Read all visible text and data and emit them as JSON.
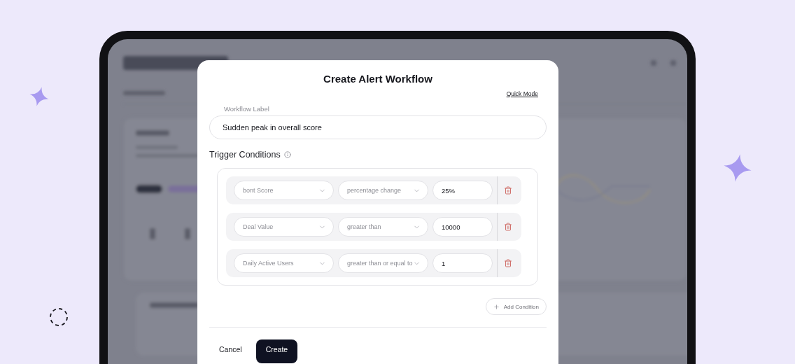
{
  "modal": {
    "title": "Create Alert Workflow",
    "quick_mode_link": "Quick Mode",
    "workflow_label": {
      "label": "Workflow Label",
      "value": "Sudden peak in overall score"
    },
    "trigger_conditions": {
      "title": "Trigger Conditions",
      "conditions": [
        {
          "metric": "bont Score",
          "operator": "percentage change",
          "value": "25%"
        },
        {
          "metric": "Deal Value",
          "operator": "greater than",
          "value": "10000"
        },
        {
          "metric": "Daily Active Users",
          "operator": "greater than or equal to",
          "value": "1"
        }
      ]
    },
    "add_condition_button": "Add Condition",
    "cancel_button": "Cancel",
    "create_button": "Create"
  }
}
